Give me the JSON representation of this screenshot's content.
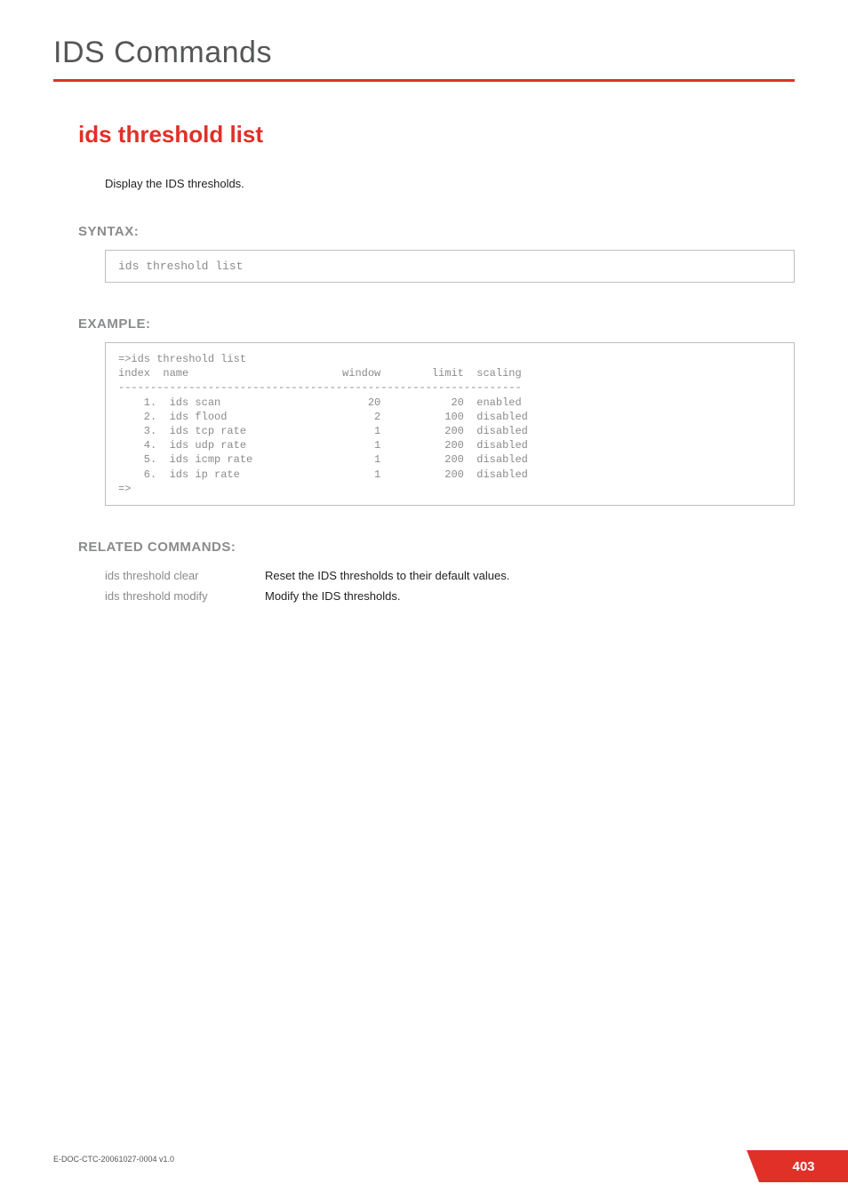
{
  "chapter_title": "IDS Commands",
  "section_title": "ids threshold list",
  "description": "Display the IDS thresholds.",
  "headings": {
    "syntax": "SYNTAX:",
    "example": "EXAMPLE:",
    "related": "RELATED COMMANDS:"
  },
  "syntax_command": "ids threshold list",
  "example_output": "=>ids threshold list\nindex  name                        window        limit  scaling\n---------------------------------------------------------------\n    1.  ids scan                       20           20  enabled\n    2.  ids flood                       2          100  disabled\n    3.  ids tcp rate                    1          200  disabled\n    4.  ids udp rate                    1          200  disabled\n    5.  ids icmp rate                   1          200  disabled\n    6.  ids ip rate                     1          200  disabled\n=>",
  "related_commands": [
    {
      "cmd": "ids threshold clear",
      "desc": "Reset the IDS thresholds to their default values."
    },
    {
      "cmd": "ids threshold modify",
      "desc": "Modify the IDS thresholds."
    }
  ],
  "footer": {
    "doc_id": "E-DOC-CTC-20061027-0004 v1.0",
    "page_number": "403"
  }
}
